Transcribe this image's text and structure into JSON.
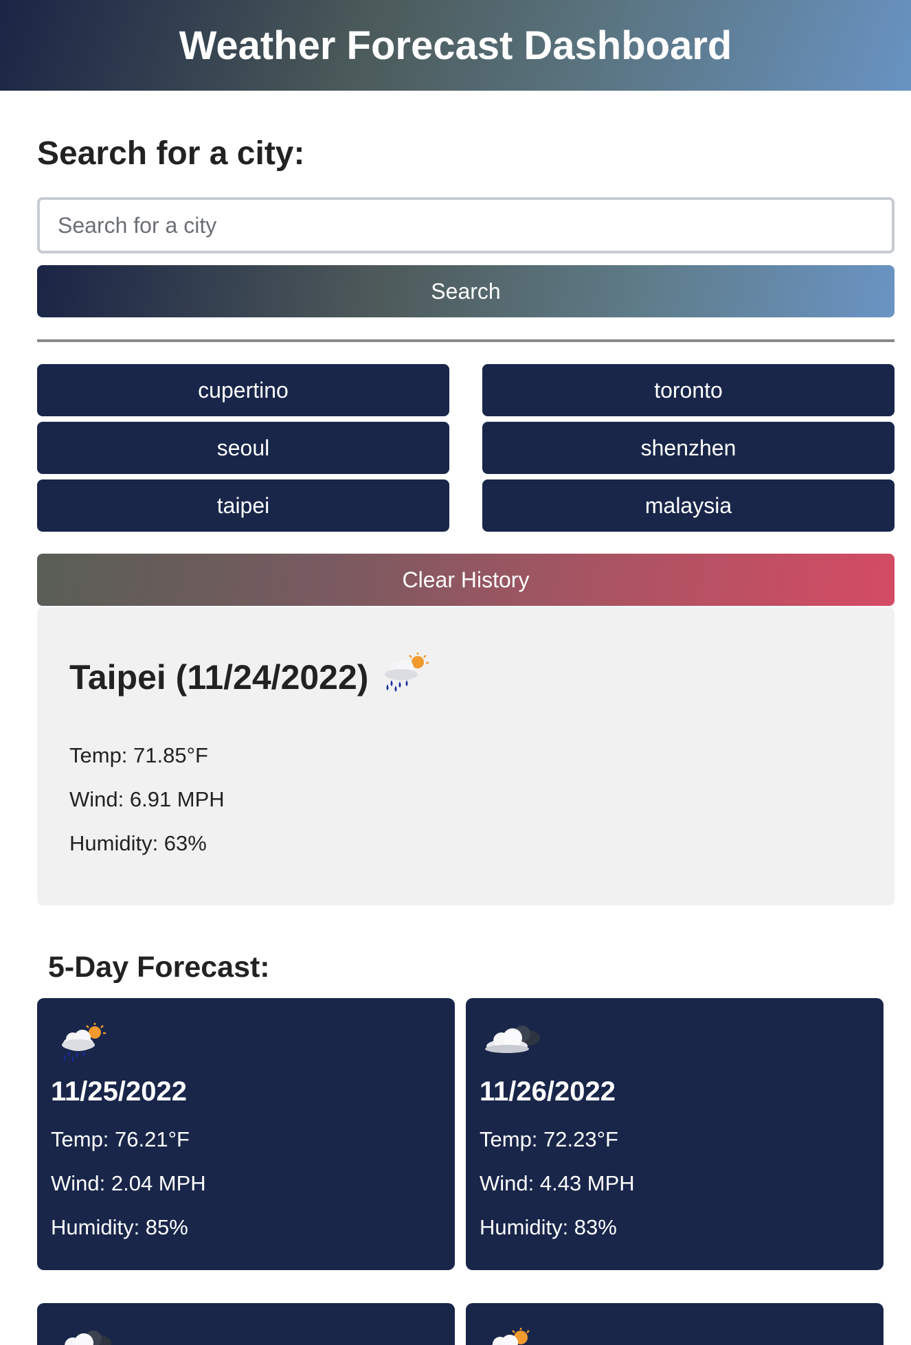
{
  "header": {
    "title": "Weather Forecast Dashboard"
  },
  "search": {
    "heading": "Search for a city:",
    "placeholder": "Search for a city",
    "value": "",
    "button_label": "Search"
  },
  "history": {
    "items": [
      {
        "label": "cupertino"
      },
      {
        "label": "toronto"
      },
      {
        "label": "seoul"
      },
      {
        "label": "shenzhen"
      },
      {
        "label": "taipei"
      },
      {
        "label": "malaysia"
      }
    ],
    "clear_label": "Clear History"
  },
  "current": {
    "title": "Taipei (11/24/2022)",
    "icon": "rain-sun-icon",
    "temp": "Temp: 71.85°F",
    "wind": "Wind: 6.91 MPH",
    "humidity": "Humidity: 63%"
  },
  "forecast": {
    "heading": "5-Day Forecast:",
    "days": [
      {
        "date": "11/25/2022",
        "icon": "rain-sun-icon",
        "temp": "Temp: 76.21°F",
        "wind": "Wind: 2.04 MPH",
        "humidity": "Humidity: 85%"
      },
      {
        "date": "11/26/2022",
        "icon": "cloud-icon",
        "temp": "Temp: 72.23°F",
        "wind": "Wind: 4.43 MPH",
        "humidity": "Humidity: 83%"
      },
      {
        "icon": "cloud-icon"
      },
      {
        "icon": "sun-cloud-icon"
      }
    ]
  },
  "colors": {
    "navy": "#19264a",
    "header_gradient_start": "#1a2445",
    "header_gradient_end": "#6893c2",
    "clear_gradient_end": "#d44b64",
    "card_bg": "#f1f1f1"
  }
}
